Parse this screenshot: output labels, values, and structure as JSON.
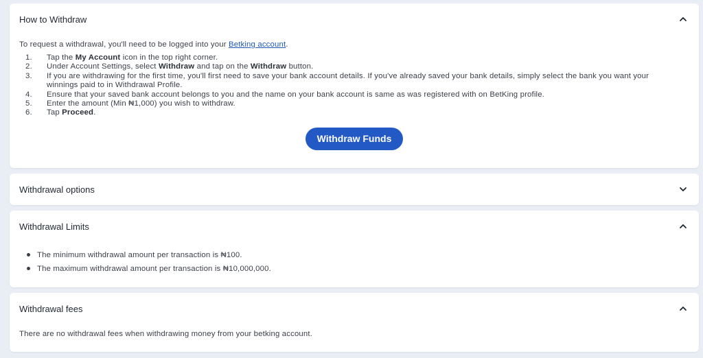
{
  "sections": [
    {
      "title": "How to Withdraw",
      "expanded": true,
      "chevron": "chevron-up-icon",
      "intro_prefix": "To request a withdrawal, you'll need to be logged into your ",
      "intro_link": "Betking account",
      "intro_suffix": ".",
      "steps": [
        {
          "num": "1.",
          "a": "Tap the ",
          "b": "My Account",
          "c": " icon in the top right corner.",
          "d": "",
          "e": ""
        },
        {
          "num": "2.",
          "a": "Under Account Settings, select ",
          "b": "Withdraw",
          "c": " and tap on the ",
          "d": "Withdraw",
          "e": " button."
        },
        {
          "num": "3.",
          "a": "If you are withdrawing for the first time, you'll first need to save your bank account details. If you've already saved your bank details, simply select the bank you want your winnings paid to in Withdrawal Profile.",
          "b": "",
          "c": "",
          "d": "",
          "e": ""
        },
        {
          "num": "4.",
          "a": "Ensure that your saved bank account belongs to you and the name on your bank account is same as was registered with on BetKing profile.",
          "b": "",
          "c": "",
          "d": "",
          "e": ""
        },
        {
          "num": "5.",
          "a": "Enter the amount (Min ₦1,000) you wish to withdraw.",
          "b": "",
          "c": "",
          "d": "",
          "e": ""
        },
        {
          "num": "6.",
          "a": "Tap ",
          "b": "Proceed",
          "c": ".",
          "d": "",
          "e": ""
        }
      ],
      "button_label": "Withdraw Funds"
    },
    {
      "title": "Withdrawal options",
      "expanded": false,
      "chevron": "chevron-down-icon"
    },
    {
      "title": "Withdrawal Limits",
      "expanded": true,
      "chevron": "chevron-up-icon",
      "bullets": [
        "The minimum withdrawal amount per transaction is ₦100.",
        "The maximum withdrawal amount per transaction is ₦10,000,000."
      ]
    },
    {
      "title": "Withdrawal fees",
      "expanded": true,
      "chevron": "chevron-up-icon",
      "text": "There are no withdrawal fees when withdrawing money from your betking account."
    }
  ],
  "colors": {
    "background": "#e9eef5",
    "card": "#ffffff",
    "accent": "#2259c4",
    "link": "#1d57b8"
  }
}
